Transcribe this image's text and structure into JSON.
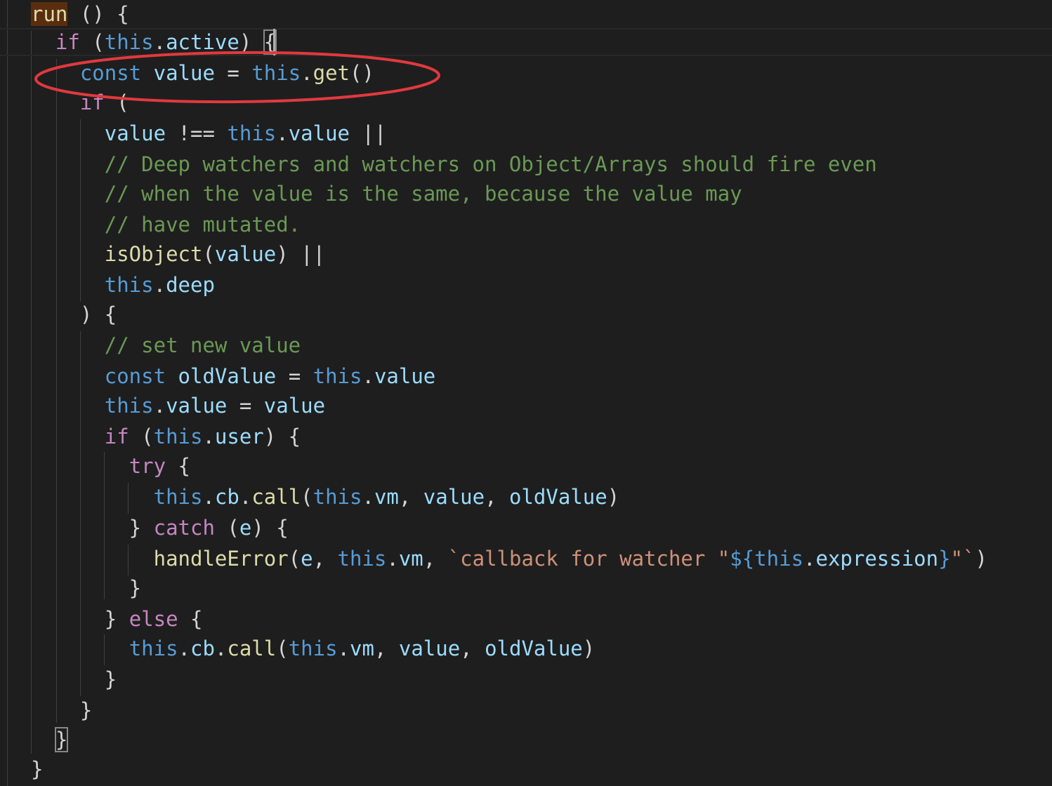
{
  "editor": {
    "lines": [
      {
        "segments": [
          {
            "t": "run",
            "c": "run-hl"
          },
          {
            "t": " () {",
            "c": "pu"
          }
        ]
      },
      {
        "segments": [
          {
            "t": "  ",
            "c": "pu"
          },
          {
            "t": "if",
            "c": "kw"
          },
          {
            "t": " (",
            "c": "pu"
          },
          {
            "t": "this",
            "c": "st"
          },
          {
            "t": ".",
            "c": "pu"
          },
          {
            "t": "active",
            "c": "var"
          },
          {
            "t": ") ",
            "c": "pu"
          },
          {
            "t": "{",
            "c": "pu bracket-box"
          }
        ]
      },
      {
        "segments": [
          {
            "t": "    ",
            "c": "pu"
          },
          {
            "t": "const",
            "c": "st"
          },
          {
            "t": " ",
            "c": "pu"
          },
          {
            "t": "value",
            "c": "var"
          },
          {
            "t": " = ",
            "c": "pu"
          },
          {
            "t": "this",
            "c": "st"
          },
          {
            "t": ".",
            "c": "pu"
          },
          {
            "t": "get",
            "c": "fn"
          },
          {
            "t": "()",
            "c": "pu"
          }
        ]
      },
      {
        "segments": [
          {
            "t": "    ",
            "c": "pu"
          },
          {
            "t": "if",
            "c": "kw"
          },
          {
            "t": " (",
            "c": "pu"
          }
        ]
      },
      {
        "segments": [
          {
            "t": "      ",
            "c": "pu"
          },
          {
            "t": "value",
            "c": "var"
          },
          {
            "t": " !== ",
            "c": "pu"
          },
          {
            "t": "this",
            "c": "st"
          },
          {
            "t": ".",
            "c": "pu"
          },
          {
            "t": "value",
            "c": "var"
          },
          {
            "t": " ||",
            "c": "pu"
          }
        ]
      },
      {
        "segments": [
          {
            "t": "      ",
            "c": "pu"
          },
          {
            "t": "// Deep watchers and watchers on Object/Arrays should fire even",
            "c": "cm"
          }
        ]
      },
      {
        "segments": [
          {
            "t": "      ",
            "c": "pu"
          },
          {
            "t": "// when the value is the same, because the value may",
            "c": "cm"
          }
        ]
      },
      {
        "segments": [
          {
            "t": "      ",
            "c": "pu"
          },
          {
            "t": "// have mutated.",
            "c": "cm"
          }
        ]
      },
      {
        "segments": [
          {
            "t": "      ",
            "c": "pu"
          },
          {
            "t": "isObject",
            "c": "fn"
          },
          {
            "t": "(",
            "c": "pu"
          },
          {
            "t": "value",
            "c": "var"
          },
          {
            "t": ") ||",
            "c": "pu"
          }
        ]
      },
      {
        "segments": [
          {
            "t": "      ",
            "c": "pu"
          },
          {
            "t": "this",
            "c": "st"
          },
          {
            "t": ".",
            "c": "pu"
          },
          {
            "t": "deep",
            "c": "var"
          }
        ]
      },
      {
        "segments": [
          {
            "t": "    ) {",
            "c": "pu"
          }
        ]
      },
      {
        "segments": [
          {
            "t": "      ",
            "c": "pu"
          },
          {
            "t": "// set new value",
            "c": "cm"
          }
        ]
      },
      {
        "segments": [
          {
            "t": "      ",
            "c": "pu"
          },
          {
            "t": "const",
            "c": "st"
          },
          {
            "t": " ",
            "c": "pu"
          },
          {
            "t": "oldValue",
            "c": "var"
          },
          {
            "t": " = ",
            "c": "pu"
          },
          {
            "t": "this",
            "c": "st"
          },
          {
            "t": ".",
            "c": "pu"
          },
          {
            "t": "value",
            "c": "var"
          }
        ]
      },
      {
        "segments": [
          {
            "t": "      ",
            "c": "pu"
          },
          {
            "t": "this",
            "c": "st"
          },
          {
            "t": ".",
            "c": "pu"
          },
          {
            "t": "value",
            "c": "var"
          },
          {
            "t": " = ",
            "c": "pu"
          },
          {
            "t": "value",
            "c": "var"
          }
        ]
      },
      {
        "segments": [
          {
            "t": "      ",
            "c": "pu"
          },
          {
            "t": "if",
            "c": "kw"
          },
          {
            "t": " (",
            "c": "pu"
          },
          {
            "t": "this",
            "c": "st"
          },
          {
            "t": ".",
            "c": "pu"
          },
          {
            "t": "user",
            "c": "var"
          },
          {
            "t": ") {",
            "c": "pu"
          }
        ]
      },
      {
        "segments": [
          {
            "t": "        ",
            "c": "pu"
          },
          {
            "t": "try",
            "c": "kw"
          },
          {
            "t": " {",
            "c": "pu"
          }
        ]
      },
      {
        "segments": [
          {
            "t": "          ",
            "c": "pu"
          },
          {
            "t": "this",
            "c": "st"
          },
          {
            "t": ".",
            "c": "pu"
          },
          {
            "t": "cb",
            "c": "var"
          },
          {
            "t": ".",
            "c": "pu"
          },
          {
            "t": "call",
            "c": "fn"
          },
          {
            "t": "(",
            "c": "pu"
          },
          {
            "t": "this",
            "c": "st"
          },
          {
            "t": ".",
            "c": "pu"
          },
          {
            "t": "vm",
            "c": "var"
          },
          {
            "t": ", ",
            "c": "pu"
          },
          {
            "t": "value",
            "c": "var"
          },
          {
            "t": ", ",
            "c": "pu"
          },
          {
            "t": "oldValue",
            "c": "var"
          },
          {
            "t": ")",
            "c": "pu"
          }
        ]
      },
      {
        "segments": [
          {
            "t": "        } ",
            "c": "pu"
          },
          {
            "t": "catch",
            "c": "kw"
          },
          {
            "t": " (",
            "c": "pu"
          },
          {
            "t": "e",
            "c": "var"
          },
          {
            "t": ") {",
            "c": "pu"
          }
        ]
      },
      {
        "segments": [
          {
            "t": "          ",
            "c": "pu"
          },
          {
            "t": "handleError",
            "c": "fn"
          },
          {
            "t": "(",
            "c": "pu"
          },
          {
            "t": "e",
            "c": "var"
          },
          {
            "t": ", ",
            "c": "pu"
          },
          {
            "t": "this",
            "c": "st"
          },
          {
            "t": ".",
            "c": "pu"
          },
          {
            "t": "vm",
            "c": "var"
          },
          {
            "t": ", ",
            "c": "pu"
          },
          {
            "t": "`callback for watcher \"",
            "c": "str"
          },
          {
            "t": "${",
            "c": "st"
          },
          {
            "t": "this",
            "c": "st"
          },
          {
            "t": ".",
            "c": "pu"
          },
          {
            "t": "expression",
            "c": "var"
          },
          {
            "t": "}",
            "c": "st"
          },
          {
            "t": "\"`",
            "c": "str"
          },
          {
            "t": ")",
            "c": "pu"
          }
        ]
      },
      {
        "segments": [
          {
            "t": "        }",
            "c": "pu"
          }
        ]
      },
      {
        "segments": [
          {
            "t": "      } ",
            "c": "pu"
          },
          {
            "t": "else",
            "c": "kw"
          },
          {
            "t": " {",
            "c": "pu"
          }
        ]
      },
      {
        "segments": [
          {
            "t": "        ",
            "c": "pu"
          },
          {
            "t": "this",
            "c": "st"
          },
          {
            "t": ".",
            "c": "pu"
          },
          {
            "t": "cb",
            "c": "var"
          },
          {
            "t": ".",
            "c": "pu"
          },
          {
            "t": "call",
            "c": "fn"
          },
          {
            "t": "(",
            "c": "pu"
          },
          {
            "t": "this",
            "c": "st"
          },
          {
            "t": ".",
            "c": "pu"
          },
          {
            "t": "vm",
            "c": "var"
          },
          {
            "t": ", ",
            "c": "pu"
          },
          {
            "t": "value",
            "c": "var"
          },
          {
            "t": ", ",
            "c": "pu"
          },
          {
            "t": "oldValue",
            "c": "var"
          },
          {
            "t": ")",
            "c": "pu"
          }
        ]
      },
      {
        "segments": [
          {
            "t": "      }",
            "c": "pu"
          }
        ]
      },
      {
        "segments": [
          {
            "t": "    }",
            "c": "pu"
          }
        ]
      },
      {
        "segments": [
          {
            "t": "  ",
            "c": "pu"
          },
          {
            "t": "}",
            "c": "pu bracket-box"
          }
        ]
      },
      {
        "segments": [
          {
            "t": "}",
            "c": "pu"
          }
        ]
      }
    ]
  },
  "colors": {
    "background": "#1e1e1e",
    "keyword": "#c586c0",
    "storage": "#569cd6",
    "variable": "#9cdcfe",
    "function": "#dcdcaa",
    "comment": "#6a9955",
    "string": "#ce9178",
    "annotation": "#e0393e"
  },
  "annotation": {
    "shape": "ellipse",
    "target": "const value = this.get()"
  }
}
